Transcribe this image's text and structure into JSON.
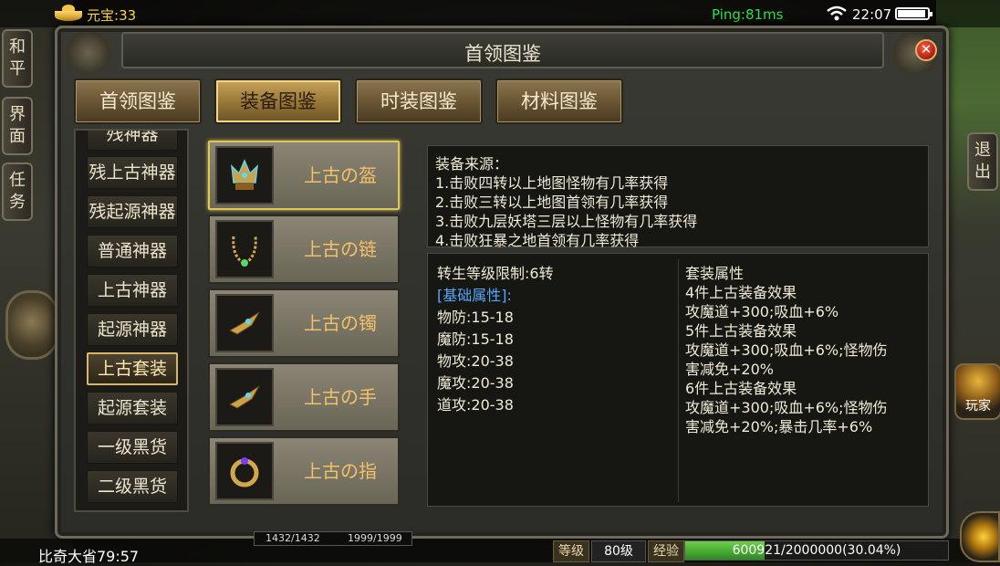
{
  "status_bar": {
    "currency_label": "元宝:",
    "currency_value": "33",
    "ping": "Ping:81ms",
    "time": "22:07"
  },
  "side_buttons": {
    "peace": "和平",
    "interface": "界面",
    "quest": "任务",
    "exit": "退出",
    "player": "玩家"
  },
  "panel": {
    "title": "首领图鉴",
    "tabs": [
      {
        "label": "首领图鉴"
      },
      {
        "label": "装备图鉴"
      },
      {
        "label": "时装图鉴"
      },
      {
        "label": "材料图鉴"
      }
    ],
    "active_tab": 1,
    "categories": [
      {
        "label": "残神器"
      },
      {
        "label": "残上古神器"
      },
      {
        "label": "残起源神器"
      },
      {
        "label": "普通神器"
      },
      {
        "label": "上古神器"
      },
      {
        "label": "起源神器"
      },
      {
        "label": "上古套装"
      },
      {
        "label": "起源套装"
      },
      {
        "label": "一级黑货"
      },
      {
        "label": "二级黑货"
      }
    ],
    "active_category": 6,
    "items": [
      {
        "label": "上古の盔",
        "icon": "helmet-icon"
      },
      {
        "label": "上古の链",
        "icon": "necklace-icon"
      },
      {
        "label": "上古の镯",
        "icon": "bracelet-icon"
      },
      {
        "label": "上古の手",
        "icon": "glove-icon"
      },
      {
        "label": "上古の指",
        "icon": "ring-icon"
      }
    ],
    "active_item": 0,
    "source": {
      "heading": "装备来源：",
      "lines": [
        "1.击败四转以上地图怪物有几率获得",
        "2.击败三转以上地图首领有几率获得",
        "3.击败九层妖塔三层以上怪物有几率获得",
        "4.击败狂暴之地首领有几率获得"
      ]
    },
    "attributes": {
      "rebirth_limit": "转生等级限制:6转",
      "base_heading": "[基础属性]:",
      "base": [
        "物防:15-18",
        "魔防:15-18",
        "物攻:20-38",
        "魔攻:20-38",
        "道攻:20-38"
      ],
      "set_heading": "套装属性",
      "set_lines": [
        "4件上古装备效果",
        "攻魔道+300;吸血+6%",
        "5件上古装备效果",
        "攻魔道+300;吸血+6%;怪物伤",
        "害减免+20%",
        "6件上古装备效果",
        "攻魔道+300;吸血+6%;怪物伤",
        "害减免+20%;暴击几率+6%"
      ]
    }
  },
  "bottom_bar": {
    "location": "比奇大省79:57",
    "hp": "1432/1432",
    "mp": "1999/1999",
    "level_label": "等级",
    "level_value": "80级",
    "exp_label": "经验",
    "exp_text": "600921/2000000(30.04%)",
    "exp_fraction": 0.3004
  },
  "colors": {
    "item_label": "#f3c06a",
    "highlight_border": "#e1c65a",
    "ping": "#29e04a",
    "currency": "#ffd94a",
    "base_attr_heading": "#58a7ff"
  }
}
